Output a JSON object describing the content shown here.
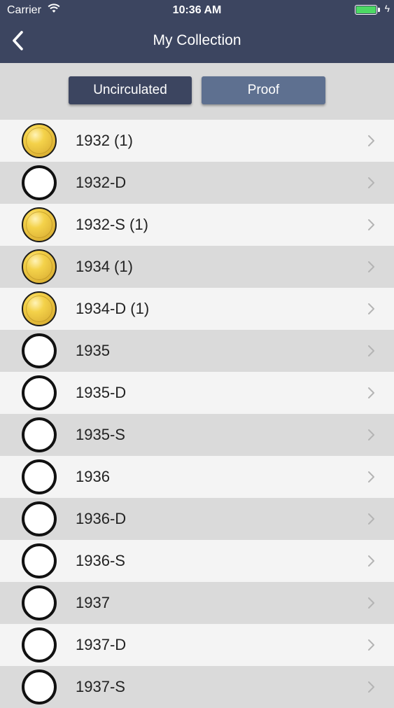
{
  "status_bar": {
    "carrier": "Carrier",
    "time": "10:36 AM",
    "battery_color": "#4cd964"
  },
  "nav": {
    "title": "My Collection",
    "back_icon": "chevron-left-icon"
  },
  "segments": [
    {
      "label": "Uncirculated",
      "selected": true
    },
    {
      "label": "Proof",
      "selected": false
    }
  ],
  "colors": {
    "navbar": "#3c4560",
    "segment_active": "#3c4560",
    "segment_inactive": "#5e7090",
    "coin_gold": "#e2b93a"
  },
  "coins": [
    {
      "label": "1932 (1)",
      "collected": true
    },
    {
      "label": "1932-D",
      "collected": false
    },
    {
      "label": "1932-S (1)",
      "collected": true
    },
    {
      "label": "1934 (1)",
      "collected": true
    },
    {
      "label": "1934-D (1)",
      "collected": true
    },
    {
      "label": "1935",
      "collected": false
    },
    {
      "label": "1935-D",
      "collected": false
    },
    {
      "label": "1935-S",
      "collected": false
    },
    {
      "label": "1936",
      "collected": false
    },
    {
      "label": "1936-D",
      "collected": false
    },
    {
      "label": "1936-S",
      "collected": false
    },
    {
      "label": "1937",
      "collected": false
    },
    {
      "label": "1937-D",
      "collected": false
    },
    {
      "label": "1937-S",
      "collected": false
    }
  ]
}
